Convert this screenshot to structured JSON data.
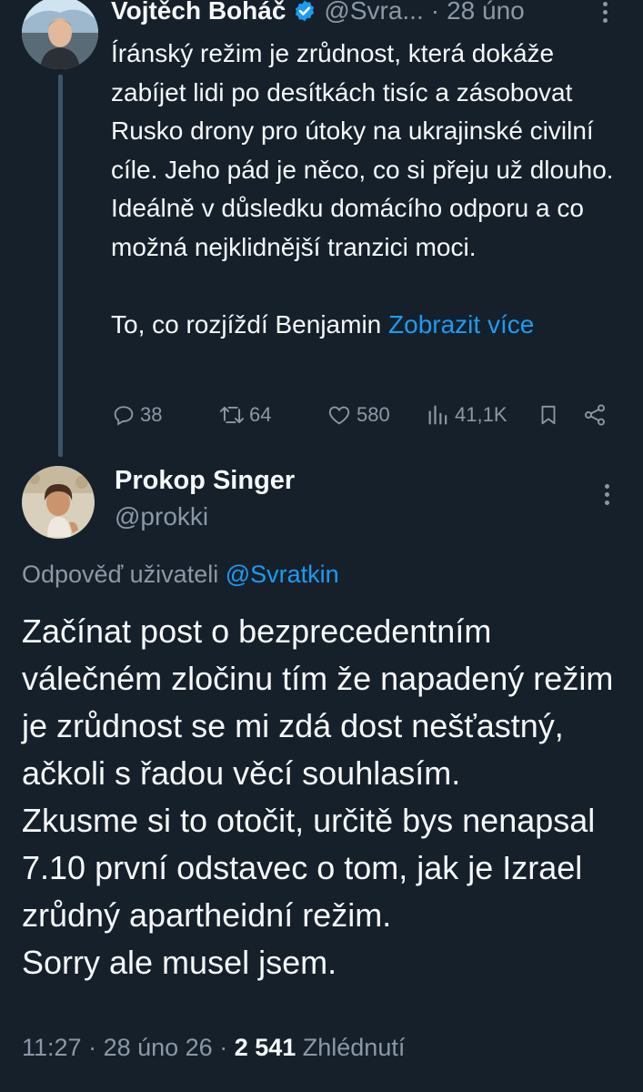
{
  "tweet1": {
    "author_name": "Vojtěch Boháč",
    "author_handle": "@Svra...",
    "separator": "·",
    "date": "28 úno",
    "text": "Íránský režim je zrůdnost, která dokáže zabíjet lidi po desítkách tisíc a zásobovat Rusko drony pro útoky na ukrajinské civilní cíle. Jeho pád je něco, co si přeju už dlouho. Ideálně v důsledku domácího odporu a co možná nejklidnější tranzici moci.\n\nTo, co rozjíždí Benjamin ",
    "show_more": "Zobrazit více",
    "replies": "38",
    "reposts": "64",
    "likes": "580",
    "views": "41,1K",
    "icons": {
      "verified": "verified-badge-icon",
      "more": "more-vertical-icon",
      "reply": "reply-icon",
      "repost": "repost-icon",
      "like": "heart-icon",
      "views": "views-icon",
      "bookmark": "bookmark-icon",
      "share": "share-icon"
    }
  },
  "tweet2": {
    "author_name": "Prokop Singer",
    "author_handle": "@prokki",
    "reply_prefix": "Odpověď uživateli ",
    "reply_mention": "@Svratkin",
    "text": "Začínat post o bezprecedentním válečném zločinu tím že napadený režim je zrůdnost  se mi zdá dost nešťastný, ačkoli s řadou věcí souhlasím.\nZkusme si to otočit, určitě bys nenapsal 7.10 první odstavec o tom, jak je Izrael zrůdný apartheidní režim.\nSorry ale musel jsem.",
    "time": "11:27",
    "sep1": " · ",
    "date": "28 úno 26",
    "sep2": " · ",
    "views_count": "2 541",
    "views_label": " Zhlédnutí"
  },
  "colors": {
    "background": "#15202b",
    "text": "#f7f9f9",
    "secondary": "#8b98a5",
    "accent": "#1d9bf0",
    "thread_line": "#3d5466"
  }
}
